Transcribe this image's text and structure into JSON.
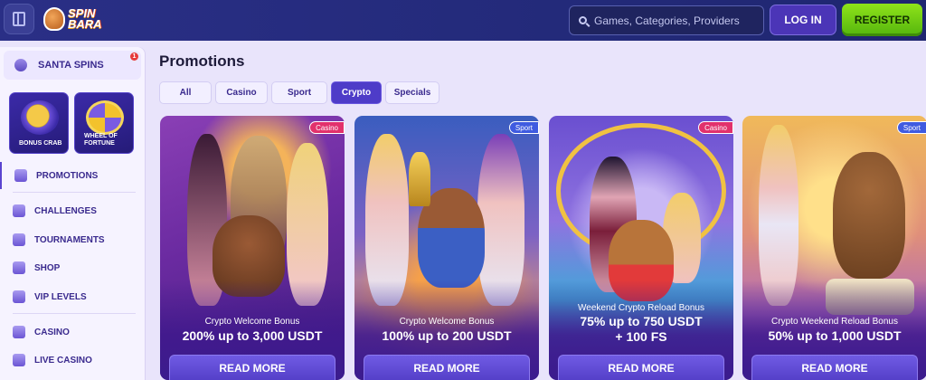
{
  "header": {
    "logo_text": "SPIN BARA",
    "search_placeholder": "Games, Categories, Providers",
    "login_label": "LOG IN",
    "register_label": "REGISTER"
  },
  "sidebar": {
    "santa": {
      "label": "SANTA SPINS",
      "badge": "1"
    },
    "tiles": [
      {
        "label": "BONUS CRAB"
      },
      {
        "label": "WHEEL OF FORTUNE"
      }
    ],
    "items": [
      {
        "label": "PROMOTIONS",
        "icon": "promotions-icon"
      },
      {
        "label": "CHALLENGES",
        "icon": "challenges-icon"
      },
      {
        "label": "TOURNAMENTS",
        "icon": "trophy-icon"
      },
      {
        "label": "SHOP",
        "icon": "shop-icon"
      },
      {
        "label": "VIP LEVELS",
        "icon": "crown-icon"
      },
      {
        "label": "CASINO",
        "icon": "casino-icon"
      },
      {
        "label": "LIVE CASINO",
        "icon": "live-casino-icon"
      }
    ]
  },
  "main": {
    "title": "Promotions",
    "tabs": [
      {
        "label": "All"
      },
      {
        "label": "Casino"
      },
      {
        "label": "Sport"
      },
      {
        "label": "Crypto",
        "active": true
      },
      {
        "label": "Specials"
      }
    ],
    "cards": [
      {
        "tag": "Casino",
        "tag_color": "#e2316c",
        "subtitle": "Crypto Welcome Bonus",
        "line1": "200% up to 3,000 USDT",
        "line2": "",
        "button": "READ MORE"
      },
      {
        "tag": "Sport",
        "tag_color": "#3f5be0",
        "subtitle": "Crypto Welcome Bonus",
        "line1": "100% up to 200 USDT",
        "line2": "",
        "button": "READ MORE"
      },
      {
        "tag": "Casino",
        "tag_color": "#e2316c",
        "subtitle": "Weekend Crypto Reload Bonus",
        "line1": "75% up to 750 USDT",
        "line2": "+ 100 FS",
        "button": "READ MORE"
      },
      {
        "tag": "Sport",
        "tag_color": "#3f5be0",
        "subtitle": "Crypto Weekend Reload Bonus",
        "line1": "50% up to 1,000 USDT",
        "line2": "",
        "button": "READ MORE"
      }
    ]
  },
  "colors": {
    "accent": "#4e3cc8",
    "register": "#6cc812",
    "header": "#262c80"
  }
}
